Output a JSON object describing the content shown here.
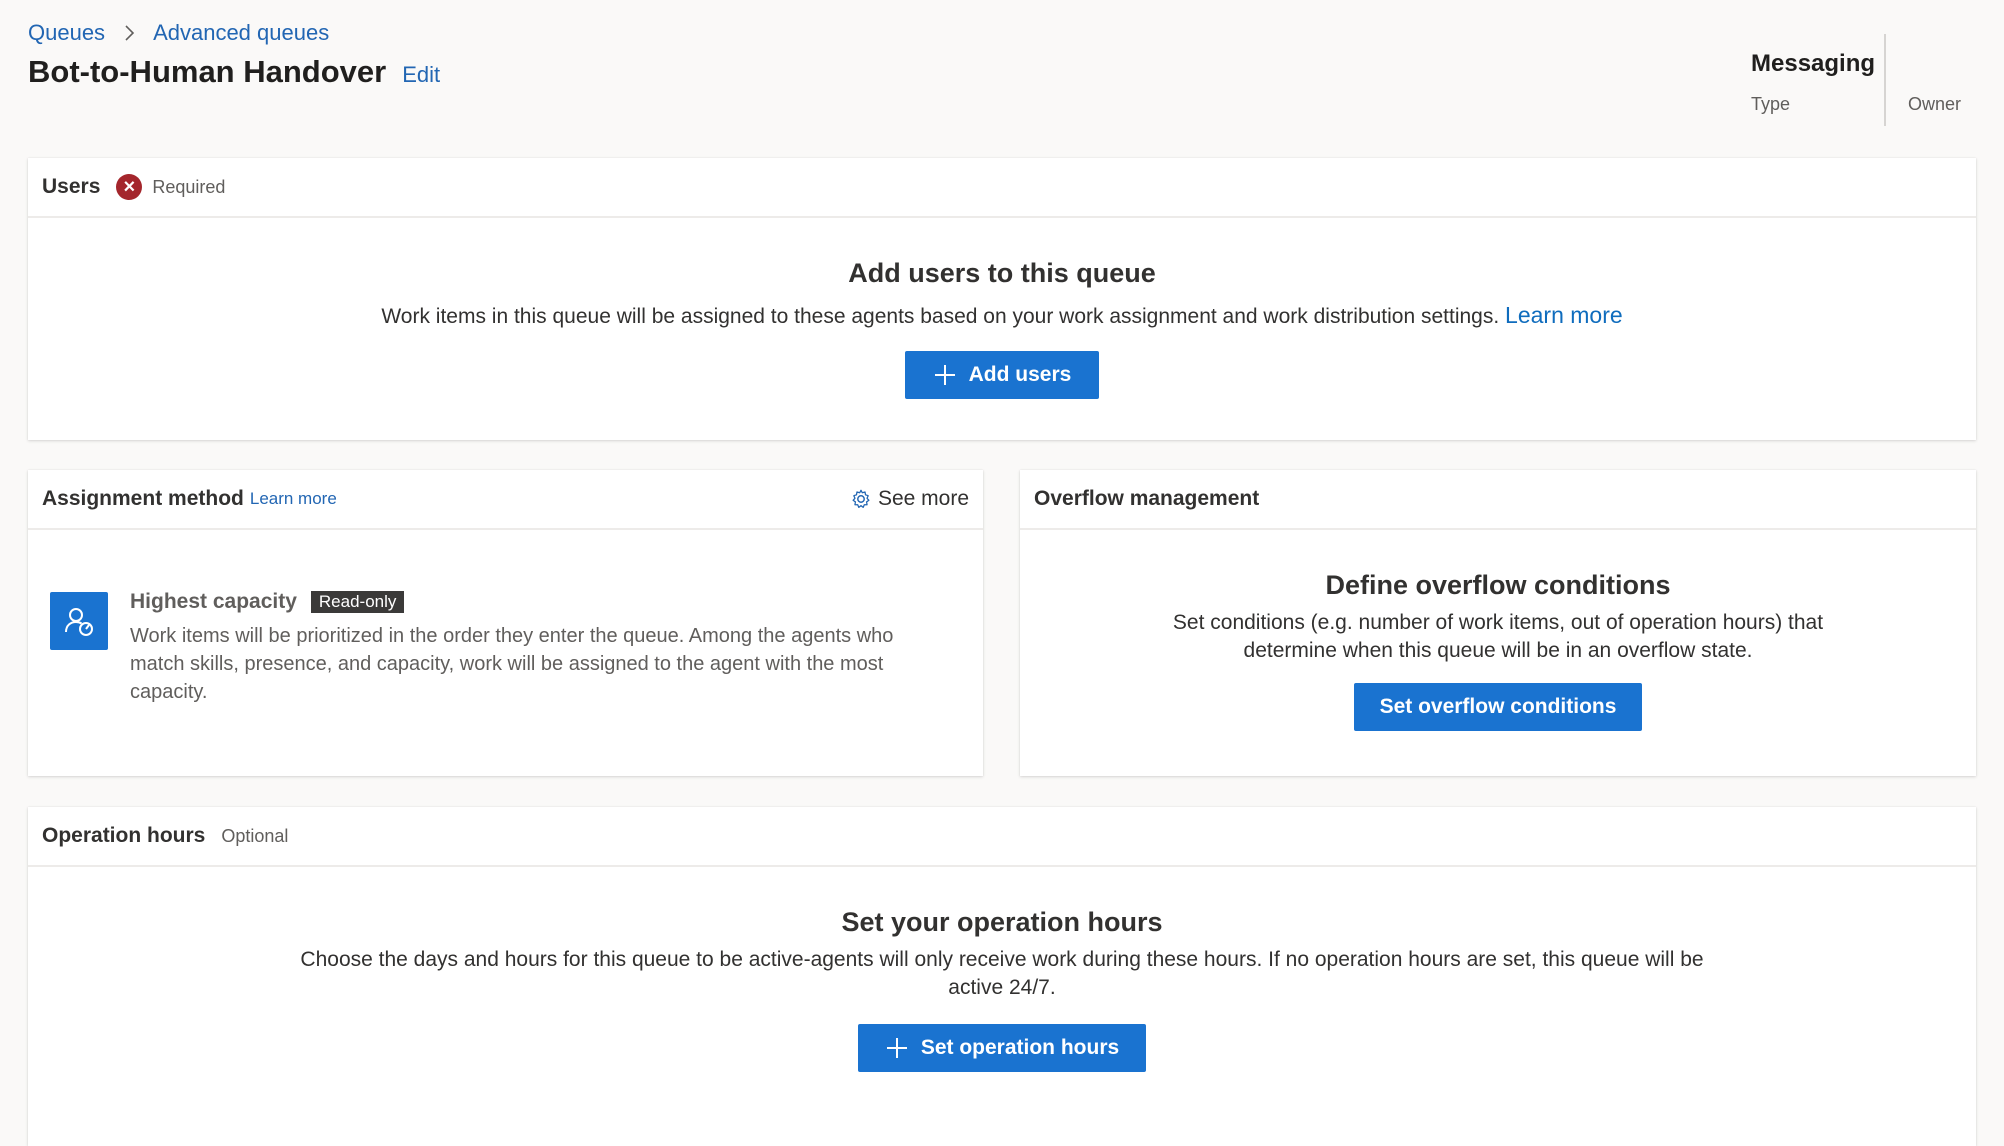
{
  "breadcrumb": {
    "root": "Queues",
    "current": "Advanced queues"
  },
  "header": {
    "title": "Bot-to-Human Handover",
    "edit_label": "Edit"
  },
  "meta": {
    "type_value": "Messaging",
    "type_label": "Type",
    "owner_value": "",
    "owner_label": "Owner"
  },
  "users": {
    "title": "Users",
    "required": "Required",
    "heading": "Add users to this queue",
    "description": "Work items in this queue will be assigned to these agents based on your work assignment and work distribution settings.",
    "learn_more": "Learn more",
    "button": "Add users"
  },
  "assignment": {
    "title": "Assignment method",
    "learn_more": "Learn more",
    "see_more": "See more",
    "method_name": "Highest capacity",
    "badge": "Read-only",
    "method_desc": "Work items will be prioritized in the order they enter the queue. Among the agents who match skills, presence, and capacity, work will be assigned to the agent with the most capacity."
  },
  "overflow": {
    "title": "Overflow management",
    "heading": "Define overflow conditions",
    "description_line1": "Set conditions (e.g. number of work items, out of operation hours) that",
    "description_line2": "determine when this queue will be in an overflow state.",
    "button": "Set overflow conditions"
  },
  "hours": {
    "title": "Operation hours",
    "optional": "Optional",
    "heading": "Set your operation hours",
    "description_line1": "Choose the days and hours for this queue to be active-agents will only receive work during these hours. If no operation hours are set, this queue will be",
    "description_line2": "active 24/7.",
    "button": "Set operation hours"
  },
  "colors": {
    "accent": "#1a73d0",
    "required": "#a4262c",
    "link": "#2266b3"
  },
  "icons": {
    "breadcrumb_separator": "chevron-right-icon",
    "required": "error-circle-icon",
    "see_more": "gear-icon",
    "method": "person-capacity-icon",
    "add": "plus-icon"
  }
}
